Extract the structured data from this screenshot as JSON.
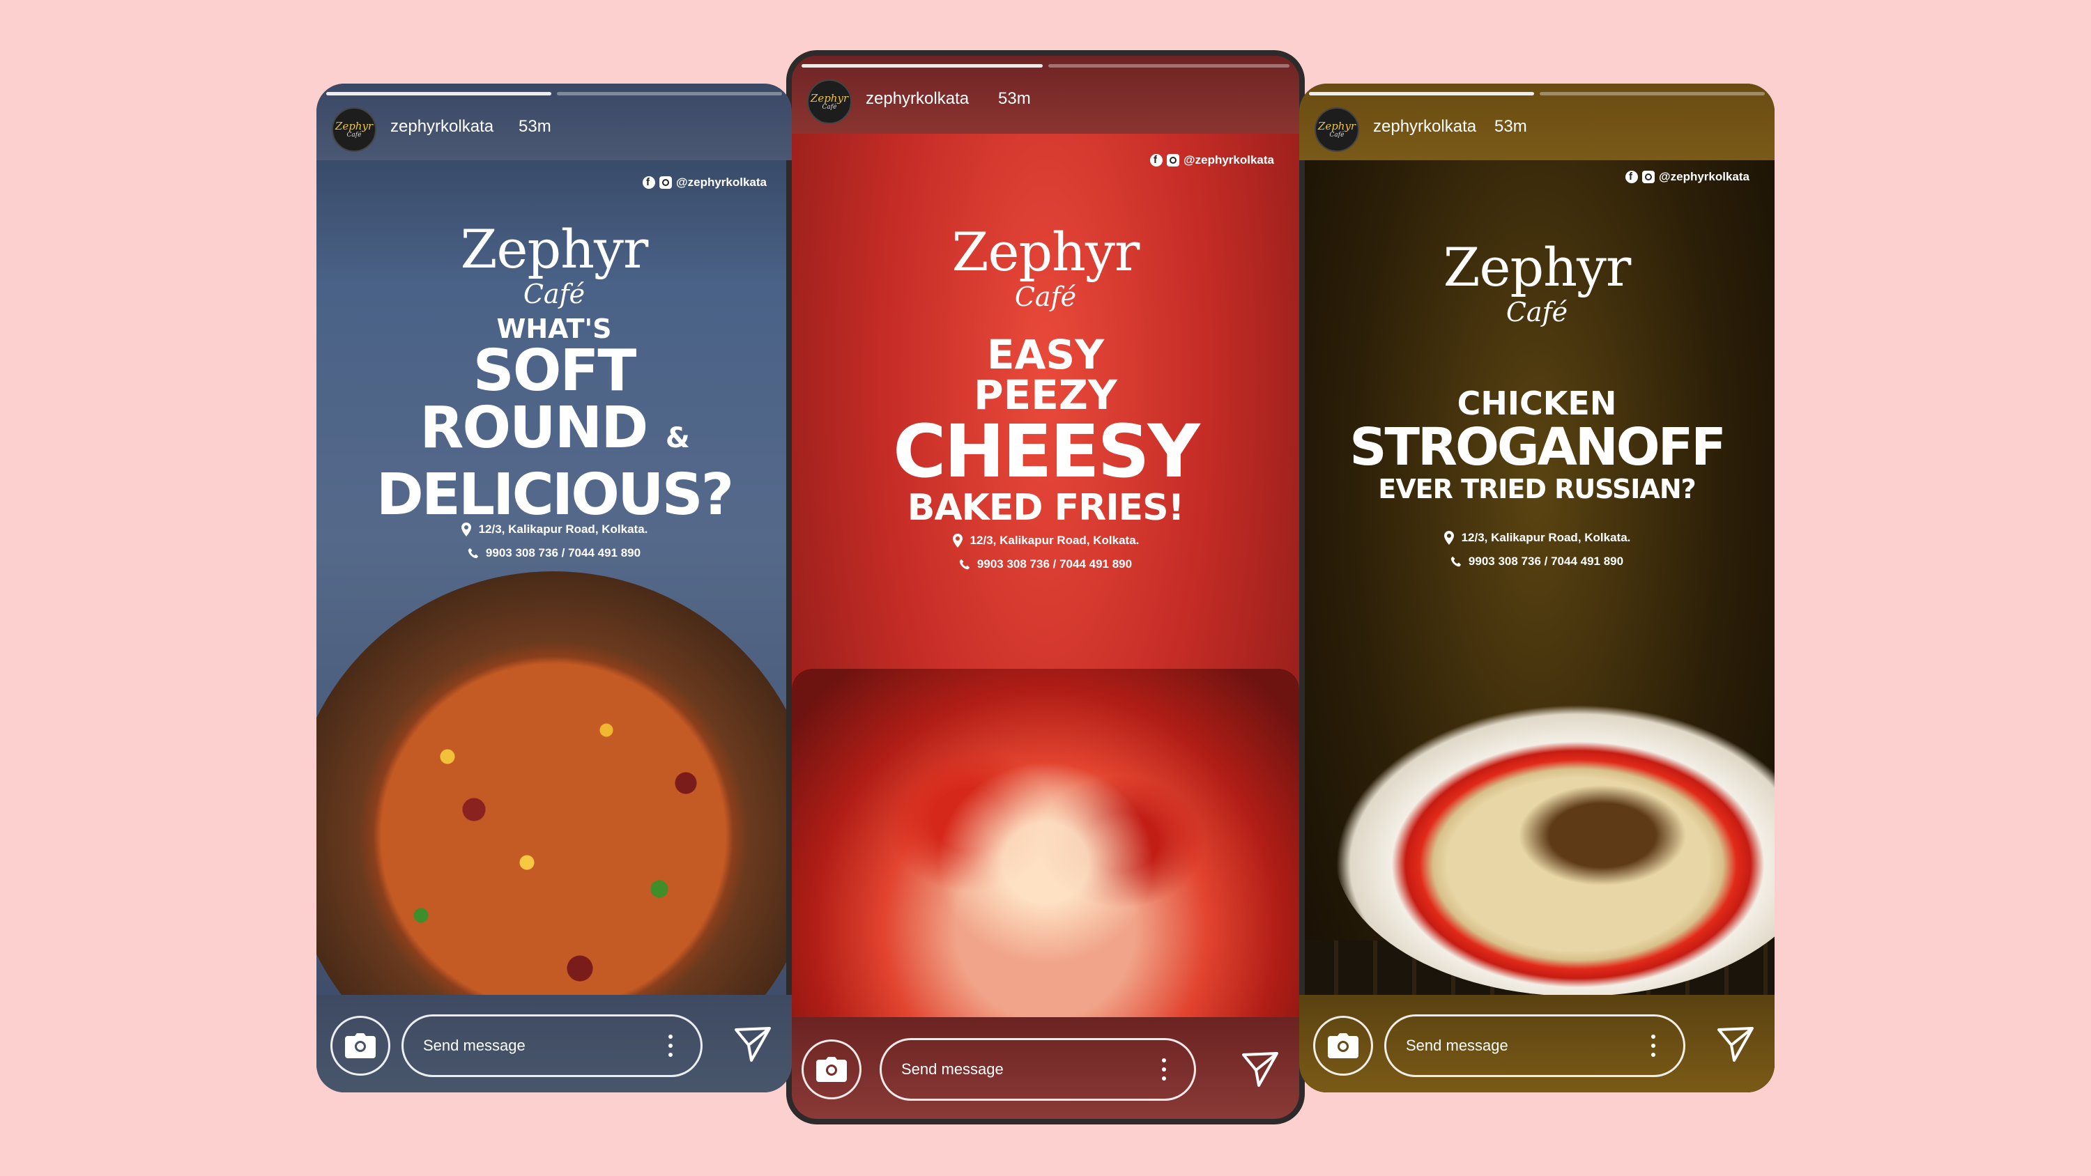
{
  "stories": {
    "pizza": {
      "username": "zephyrkolkata",
      "time": "53m",
      "social_handle": "@zephyrkolkata",
      "brand_name": "Zephyr",
      "brand_sub": "Café",
      "headline": {
        "line1": "WHAT'S",
        "line2": "SOFT",
        "line3": "ROUND",
        "amp": "&",
        "line4": "DELICIOUS?"
      },
      "address": "12/3, Kalikapur Road, Kolkata.",
      "phone": "9903 308 736 / 7044 491 890",
      "message_placeholder": "Send message"
    },
    "fries": {
      "username": "zephyrkolkata",
      "time": "53m",
      "social_handle": "@zephyrkolkata",
      "brand_name": "Zephyr",
      "brand_sub": "Café",
      "headline": {
        "line1": "EASY",
        "line2": "PEEZY",
        "line3": "CHEESY",
        "line4": "BAKED FRIES!"
      },
      "address": "12/3, Kalikapur Road, Kolkata.",
      "phone": "9903 308 736 / 7044 491 890",
      "message_placeholder": "Send message"
    },
    "strog": {
      "username": "zephyrkolkata",
      "time": "53m",
      "social_handle": "@zephyrkolkata",
      "brand_name": "Zephyr",
      "brand_sub": "Café",
      "headline": {
        "line1": "CHICKEN",
        "line2": "STROGANOFF",
        "line3": "EVER TRIED RUSSIAN?"
      },
      "address": "12/3, Kalikapur Road, Kolkata.",
      "phone": "9903 308 736 / 7044 491 890",
      "message_placeholder": "Send message"
    }
  },
  "avatar_logo": {
    "main": "Zephyr",
    "sub": "Café"
  },
  "colors": {
    "page_bg": "#fbd0cf",
    "pizza_bg": "#4a6287",
    "fries_bg": "#c52c26",
    "strog_bg": "#2c1f08",
    "avatar_gold": "#e9c545"
  },
  "icons": [
    "camera-icon",
    "more-vertical-icon",
    "send-icon",
    "facebook-icon",
    "instagram-icon",
    "location-pin-icon",
    "phone-icon"
  ]
}
